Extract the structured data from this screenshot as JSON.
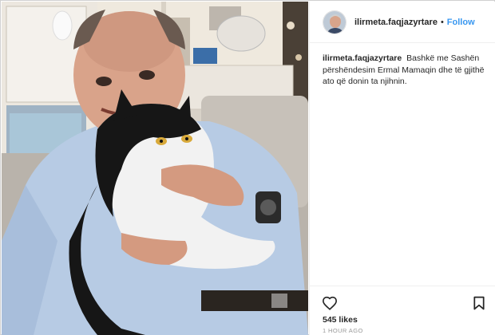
{
  "post": {
    "username": "ilirmeta.faqjazyrtare",
    "separator": "•",
    "follow_label": "Follow",
    "caption_text": "Bashkë me Sashën përshëndesim Ermal Mamaqin dhe të gjithë ato që donin ta njihnin.",
    "likes": "545 likes",
    "timestamp": "1 HOUR AGO"
  },
  "icons": {
    "like": "heart-icon",
    "save": "bookmark-icon"
  },
  "colors": {
    "follow": "#3897f0",
    "text": "#262626",
    "muted": "#999999",
    "border": "#efefef"
  }
}
